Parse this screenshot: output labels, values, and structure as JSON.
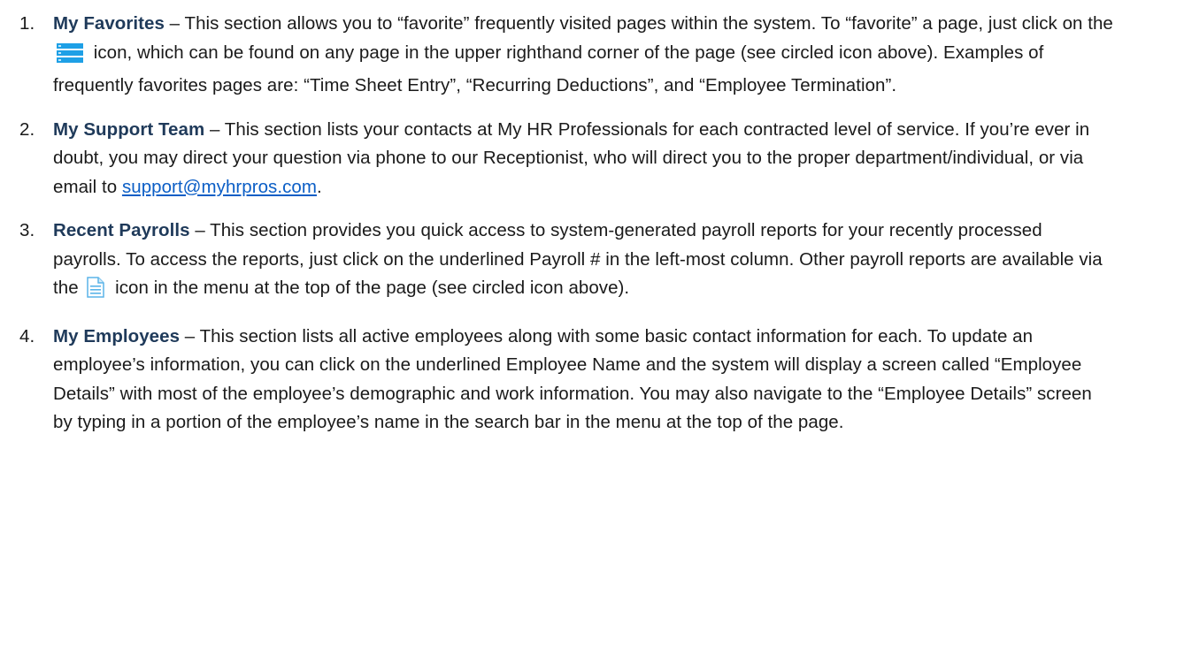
{
  "items": [
    {
      "number": "1.",
      "title": "My Favorites",
      "text_before_icon": " – This section allows you to “favorite” frequently visited pages within the system. To “favorite” a page, just click on the ",
      "icon": "list-icon",
      "text_after_icon": " icon, which can be found on any page in the upper righthand corner of the page (see circled icon above). Examples of frequently favorites pages are: “Time Sheet Entry”, “Recurring Deductions”, and “Employee Termination”."
    },
    {
      "number": "2.",
      "title": "My Support Team",
      "text_before_link": " – This section lists your contacts at My HR Professionals for each contracted level of service. If you’re ever in doubt, you may direct your question via phone to our Receptionist, who will direct you to the proper department/individual, or via email to ",
      "link": "support@myhrpros.com",
      "text_after_link": "."
    },
    {
      "number": "3.",
      "title": "Recent Payrolls",
      "text_before_icon": " – This section provides you quick access to system-generated payroll reports for your recently processed payrolls. To access the reports, just click on the underlined Payroll # in the left-most column. Other payroll reports are available via the ",
      "icon": "document-icon",
      "text_after_icon": " icon in the menu at the top of the page (see circled icon above)."
    },
    {
      "number": "4.",
      "title": "My Employees",
      "text": " – This section lists all active employees along with some basic contact information for each. To update an employee’s information, you can click on the underlined Employee Name and the system will display a screen called “Employee Details” with most of the employee’s demographic and work information. You may also navigate to the “Employee Details” screen by typing in a portion of the employee’s name in the search bar in the menu at the top of the page."
    }
  ],
  "colors": {
    "title": "#1f3a5a",
    "link": "#0b5ec6",
    "icon_blue": "#1ea0e6",
    "icon_doc": "#5ab4e8"
  }
}
